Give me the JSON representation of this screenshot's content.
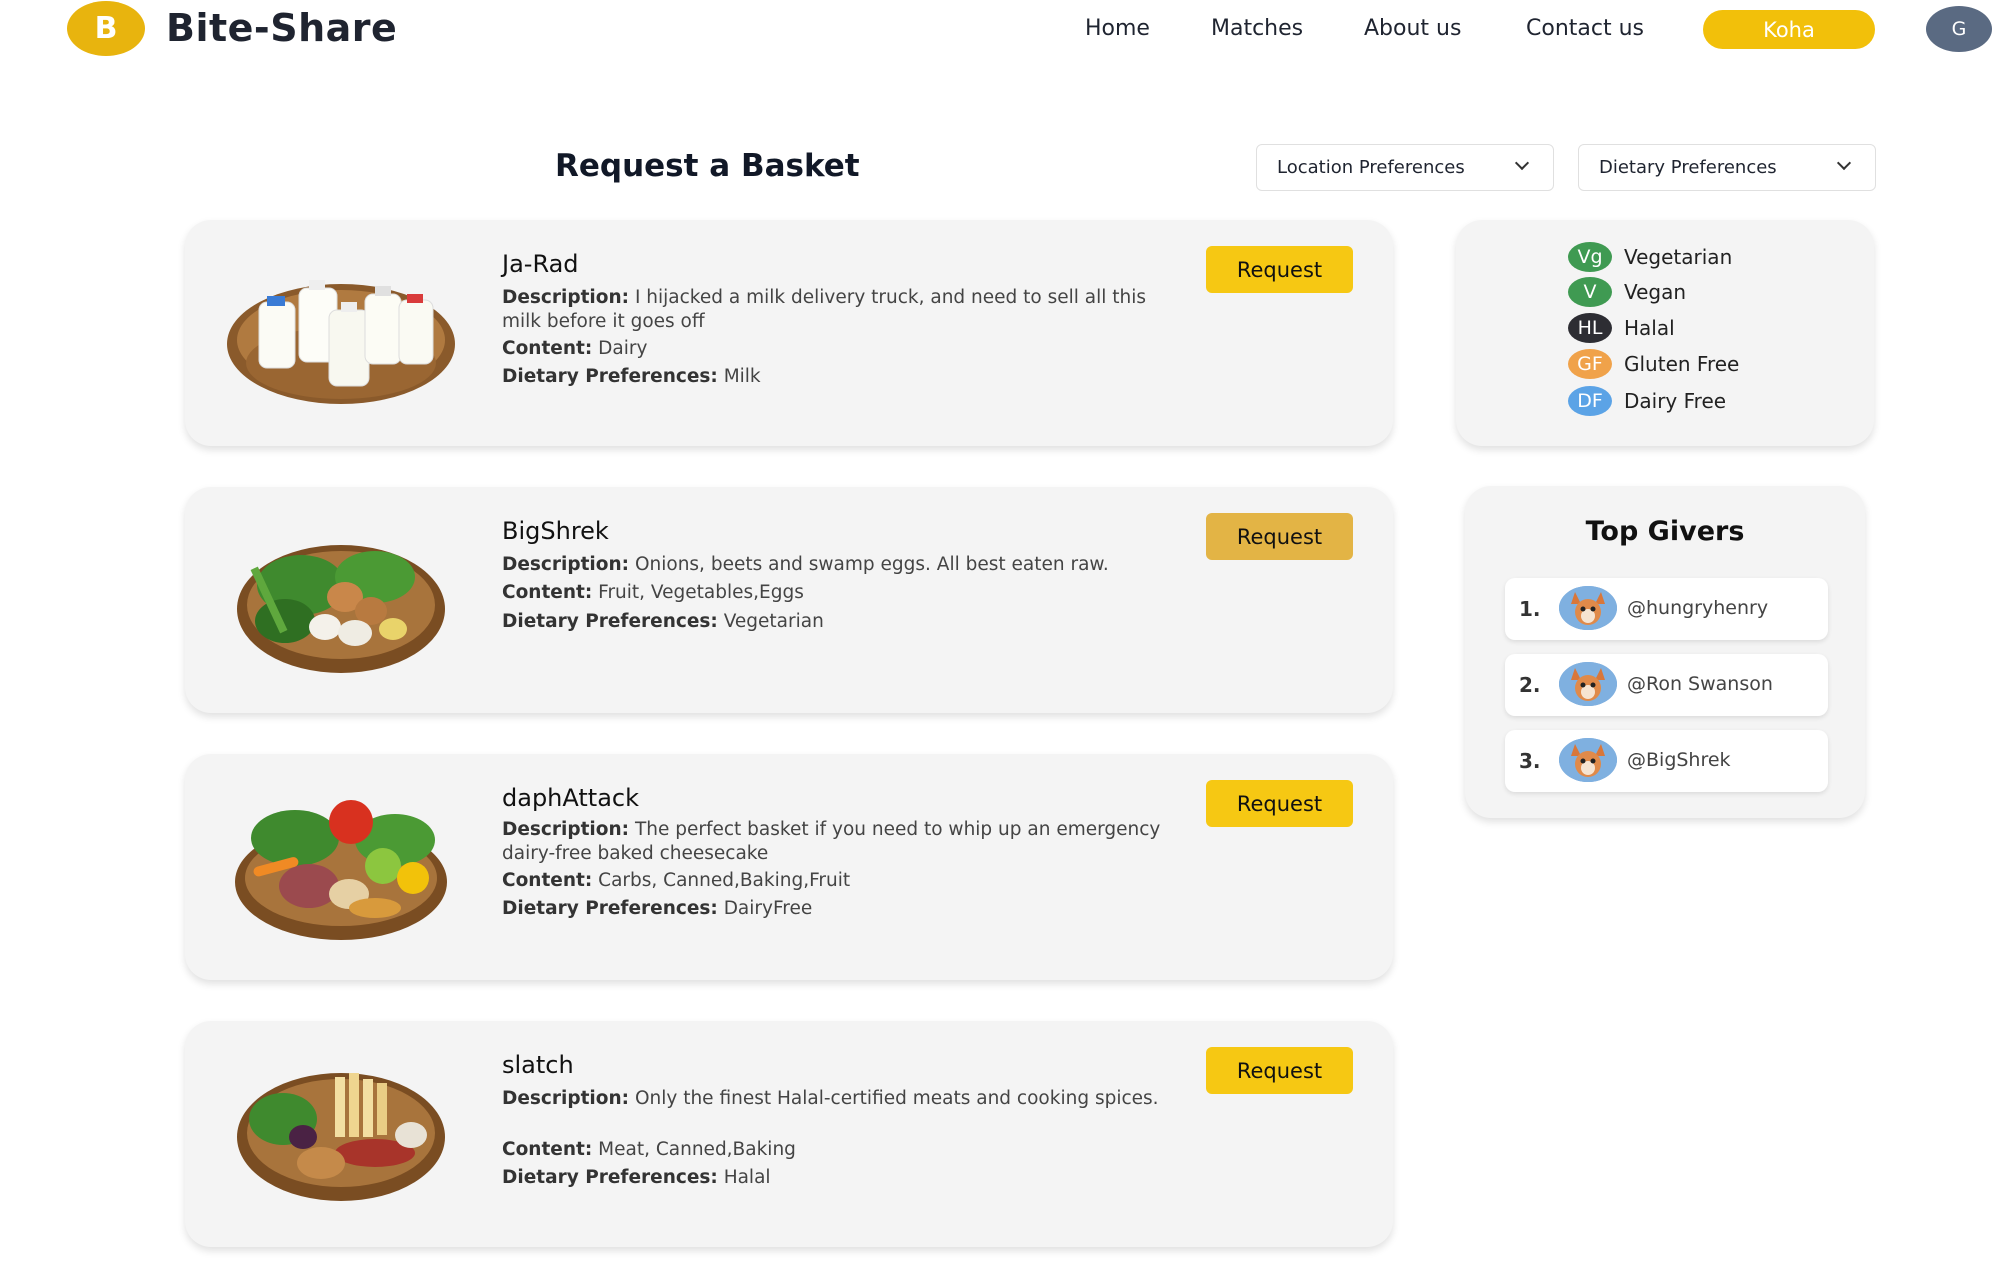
{
  "header": {
    "logo_letter": "B",
    "brand": "Bite-Share",
    "nav": [
      "Home",
      "Matches",
      "About us",
      "Contact us"
    ],
    "koha": "Koha",
    "avatar_letter": "G"
  },
  "page": {
    "title": "Request a Basket",
    "location_dropdown": "Location Preferences",
    "dietary_dropdown": "Dietary Preferences"
  },
  "labels": {
    "description": "Description:",
    "content": "Content:",
    "dietary": "Dietary Preferences:",
    "request": "Request"
  },
  "baskets": [
    {
      "user": "Ja-Rad",
      "description": "I hijacked a milk delivery truck, and need to sell all this milk before it goes off",
      "content": "Dairy",
      "dietary": "Milk"
    },
    {
      "user": "BigShrek",
      "description": "Onions, beets and swamp eggs. All best eaten raw.",
      "content": "Fruit, Vegetables,Eggs",
      "dietary": "Vegetarian"
    },
    {
      "user": "daphAttack",
      "description": "The perfect basket if you need to whip up an emergency dairy-free baked cheesecake",
      "content": "Carbs, Canned,Baking,Fruit",
      "dietary": "DairyFree"
    },
    {
      "user": "slatch",
      "description": "Only the finest Halal-certified meats and cooking spices.",
      "content": "Meat, Canned,Baking",
      "dietary": "Halal"
    }
  ],
  "legend": [
    {
      "code": "Vg",
      "label": "Vegetarian",
      "color": "#3f9a52"
    },
    {
      "code": "V",
      "label": "Vegan",
      "color": "#3f9a52"
    },
    {
      "code": "HL",
      "label": "Halal",
      "color": "#2d2d33"
    },
    {
      "code": "GF",
      "label": "Gluten Free",
      "color": "#f0a24a"
    },
    {
      "code": "DF",
      "label": "Dairy Free",
      "color": "#5ba3e6"
    }
  ],
  "top_givers": {
    "title": "Top Givers",
    "items": [
      {
        "rank": "1.",
        "name": "@hungryhenry"
      },
      {
        "rank": "2.",
        "name": "@Ron Swanson"
      },
      {
        "rank": "3.",
        "name": "@BigShrek"
      }
    ]
  },
  "colors": {
    "accent": "#f6c813",
    "brand_circle": "#e8b40e",
    "card_bg": "#f4f4f4"
  }
}
